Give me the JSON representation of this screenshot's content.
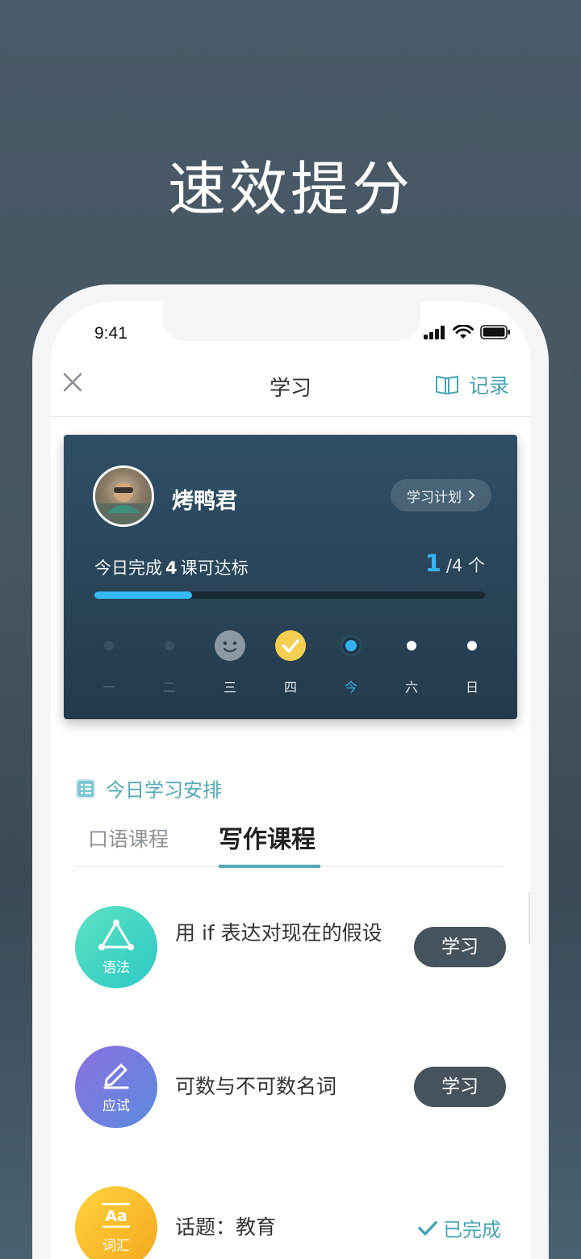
{
  "promo": {
    "title": "速效提分"
  },
  "status_bar": {
    "time": "9:41"
  },
  "nav": {
    "title": "学习",
    "record_label": "记录"
  },
  "card": {
    "user_name": "烤鸭君",
    "plan_label": "学习计划",
    "goal_prefix": "今日完成",
    "goal_number": "4",
    "goal_suffix": "课可达标",
    "done_count": "1",
    "total_text": "/4 个",
    "progress": 0.25,
    "week": [
      {
        "label": "一",
        "state": "missed"
      },
      {
        "label": "二",
        "state": "missed"
      },
      {
        "label": "三",
        "state": "partial"
      },
      {
        "label": "四",
        "state": "done"
      },
      {
        "label": "今",
        "state": "today"
      },
      {
        "label": "六",
        "state": "future"
      },
      {
        "label": "日",
        "state": "future"
      }
    ]
  },
  "schedule": {
    "heading": "今日学习安排",
    "tabs": [
      {
        "label": "口语课程"
      },
      {
        "label": "写作课程"
      }
    ],
    "active_tab": 1
  },
  "lessons": [
    {
      "category": "语法",
      "icon": "triangle-icon",
      "title": "用 if 表达对现在的假设",
      "action": "学习",
      "colors": [
        "#5ee2c0",
        "#2cc9c6"
      ]
    },
    {
      "category": "应试",
      "icon": "pencil-icon",
      "title": "可数与不可数名词",
      "action": "学习",
      "colors": [
        "#8c6fe2",
        "#5b8cdc"
      ]
    },
    {
      "category": "词汇",
      "icon": "aa-icon",
      "title": "话题：教育",
      "action": "已完成",
      "colors": [
        "#ffd33d",
        "#f4a81c"
      ]
    }
  ],
  "colors": {
    "accent": "#47a4b6",
    "progress": "#35b9f3",
    "button": "#46525c"
  }
}
